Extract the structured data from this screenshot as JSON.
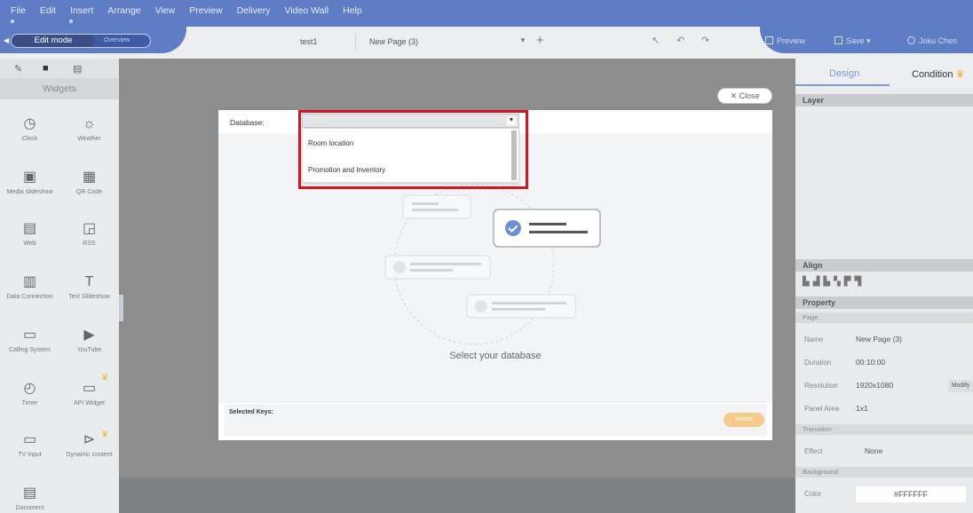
{
  "menubar": {
    "items": [
      "File",
      "Edit",
      "Insert",
      "Arrange",
      "View",
      "Preview",
      "Delivery",
      "Video Wall",
      "Help"
    ]
  },
  "toolbar": {
    "edit_mode": "Edit mode",
    "overview": "Overview",
    "project": "test1",
    "page": "New Page (3)",
    "preview": "Preview",
    "save": "Save",
    "user": "Joku Chen"
  },
  "widgets": {
    "header": "Widgets",
    "items": [
      {
        "label": "Clock",
        "icon": "clock-icon"
      },
      {
        "label": "Weather",
        "icon": "weather-icon"
      },
      {
        "label": "Media slideshow",
        "icon": "media-slideshow-icon"
      },
      {
        "label": "QR Code",
        "icon": "qr-code-icon"
      },
      {
        "label": "Web",
        "icon": "web-icon"
      },
      {
        "label": "RSS",
        "icon": "rss-icon"
      },
      {
        "label": "Data Connection",
        "icon": "data-connection-icon"
      },
      {
        "label": "Text Slideshow",
        "icon": "text-slideshow-icon"
      },
      {
        "label": "Calling System",
        "icon": "calling-system-icon"
      },
      {
        "label": "YouTube",
        "icon": "youtube-icon"
      },
      {
        "label": "Timer",
        "icon": "timer-icon"
      },
      {
        "label": "API Widget",
        "icon": "api-widget-icon"
      },
      {
        "label": "TV Input",
        "icon": "tv-input-icon"
      },
      {
        "label": "Dynamic content",
        "icon": "dynamic-content-icon"
      },
      {
        "label": "Document",
        "icon": "document-icon"
      }
    ]
  },
  "dialog": {
    "close": "Close",
    "database_label": "Database:",
    "options": [
      "Room location",
      "Promotion and Inventory"
    ],
    "select_prompt": "Select your database",
    "selected_keys": "Selected Keys:",
    "import": "Import"
  },
  "right": {
    "tab_design": "Design",
    "tab_condition": "Condition",
    "layer": "Layer",
    "align": "Align",
    "property": "Property",
    "page_section": "Page",
    "name_k": "Name",
    "name_v": "New Page (3)",
    "duration_k": "Duration",
    "duration_v": "00:10:00",
    "resolution_k": "Resolution",
    "resolution_v": "1920x1080",
    "modify": "Modify",
    "panel_k": "Panel Area",
    "panel_v": "1x1",
    "transition": "Transition",
    "effect_k": "Effect",
    "effect_v": "None",
    "background": "Background",
    "color_k": "Color",
    "color_v": "#FFFFFF"
  },
  "colors": {
    "menubar": "#5f7dc4",
    "highlight": "#d6141c",
    "import_btn": "#f7c98a",
    "accent": "#7b9bd6"
  }
}
